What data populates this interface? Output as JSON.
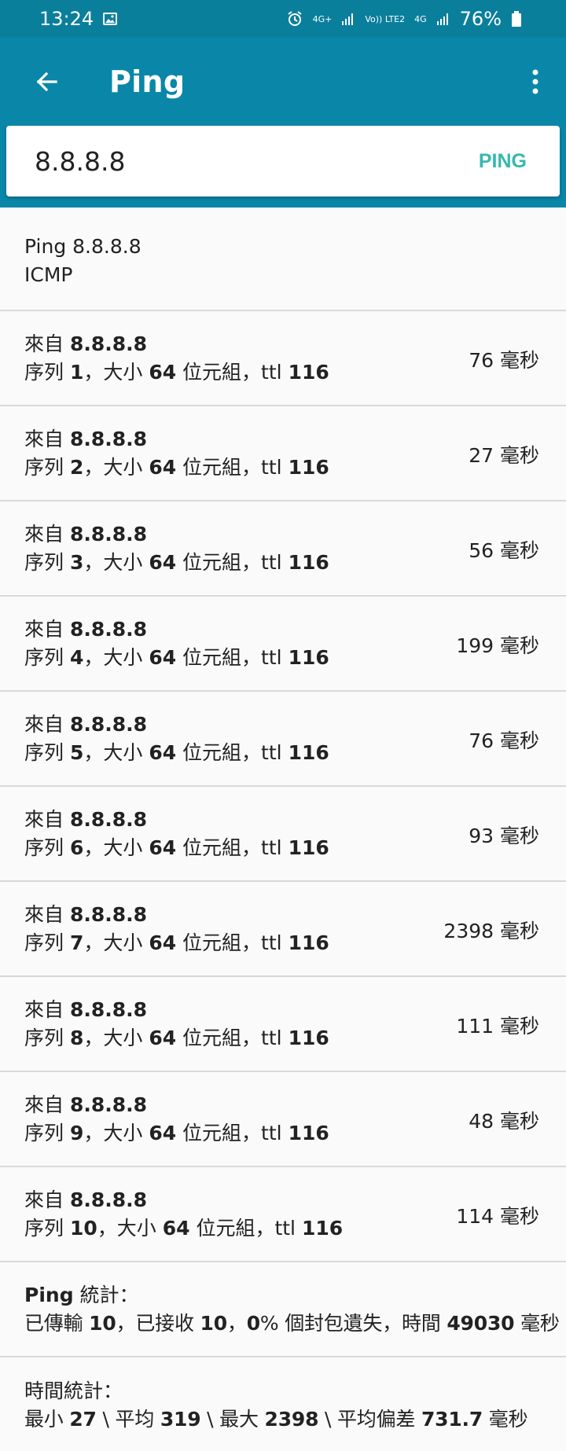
{
  "status_bar": {
    "time": "13:24",
    "signal_4g_plus": "4G+",
    "signal_lte2": "Vo)) LTE2",
    "signal_4g": "4G",
    "battery": "76%"
  },
  "app_bar": {
    "title": "Ping"
  },
  "search": {
    "value": "8.8.8.8",
    "ping_label": "PING"
  },
  "header": {
    "line1": "Ping 8.8.8.8",
    "line2": "ICMP"
  },
  "results": [
    {
      "from_prefix": "來自 ",
      "host": "8.8.8.8",
      "seq_prefix": "序列 ",
      "seq": "1",
      "size_prefix": "，大小 ",
      "size": "64",
      "size_unit": " 位元組，ttl ",
      "ttl": "116",
      "time": "76 毫秒"
    },
    {
      "from_prefix": "來自 ",
      "host": "8.8.8.8",
      "seq_prefix": "序列 ",
      "seq": "2",
      "size_prefix": "，大小 ",
      "size": "64",
      "size_unit": " 位元組，ttl ",
      "ttl": "116",
      "time": "27 毫秒"
    },
    {
      "from_prefix": "來自 ",
      "host": "8.8.8.8",
      "seq_prefix": "序列 ",
      "seq": "3",
      "size_prefix": "，大小 ",
      "size": "64",
      "size_unit": " 位元組，ttl ",
      "ttl": "116",
      "time": "56 毫秒"
    },
    {
      "from_prefix": "來自 ",
      "host": "8.8.8.8",
      "seq_prefix": "序列 ",
      "seq": "4",
      "size_prefix": "，大小 ",
      "size": "64",
      "size_unit": " 位元組，ttl ",
      "ttl": "116",
      "time": "199 毫秒"
    },
    {
      "from_prefix": "來自 ",
      "host": "8.8.8.8",
      "seq_prefix": "序列 ",
      "seq": "5",
      "size_prefix": "，大小 ",
      "size": "64",
      "size_unit": " 位元組，ttl ",
      "ttl": "116",
      "time": "76 毫秒"
    },
    {
      "from_prefix": "來自 ",
      "host": "8.8.8.8",
      "seq_prefix": "序列 ",
      "seq": "6",
      "size_prefix": "，大小 ",
      "size": "64",
      "size_unit": " 位元組，ttl ",
      "ttl": "116",
      "time": "93 毫秒"
    },
    {
      "from_prefix": "來自 ",
      "host": "8.8.8.8",
      "seq_prefix": "序列 ",
      "seq": "7",
      "size_prefix": "，大小 ",
      "size": "64",
      "size_unit": " 位元組，ttl ",
      "ttl": "116",
      "time": "2398 毫秒"
    },
    {
      "from_prefix": "來自 ",
      "host": "8.8.8.8",
      "seq_prefix": "序列 ",
      "seq": "8",
      "size_prefix": "，大小 ",
      "size": "64",
      "size_unit": " 位元組，ttl ",
      "ttl": "116",
      "time": "111 毫秒"
    },
    {
      "from_prefix": "來自 ",
      "host": "8.8.8.8",
      "seq_prefix": "序列 ",
      "seq": "9",
      "size_prefix": "，大小 ",
      "size": "64",
      "size_unit": " 位元組，ttl ",
      "ttl": "116",
      "time": "48 毫秒"
    },
    {
      "from_prefix": "來自 ",
      "host": "8.8.8.8",
      "seq_prefix": "序列 ",
      "seq": "10",
      "size_prefix": "，大小 ",
      "size": "64",
      "size_unit": " 位元組，ttl ",
      "ttl": "116",
      "time": "114 毫秒"
    }
  ],
  "ping_stats": {
    "title_bold": "Ping",
    "title_rest": " 統計：",
    "line2_a": "已傳輸 ",
    "transmitted": "10",
    "line2_b": "，已接收 ",
    "received": "10",
    "line2_c": "，",
    "loss": "0",
    "line2_d": "% 個封包遺失，時間 ",
    "time_total": "49030",
    "line2_e": " 毫秒"
  },
  "time_stats": {
    "title": "時間統計：",
    "min_label": "最小 ",
    "min": "27",
    "avg_label": " \\ 平均 ",
    "avg": "319",
    "max_label": " \\ 最大 ",
    "max": "2398",
    "mdev_label": " \\ 平均偏差 ",
    "mdev": "731.7",
    "unit": " 毫秒"
  },
  "colors": {
    "status_bar": "#0a7f9c",
    "app_bar": "#0a87a8",
    "ping_button": "#35b8b0",
    "divider": "#d9d9d9"
  },
  "icons": {
    "back": "arrow-left-icon",
    "menu": "more-vertical-icon",
    "image": "image-icon",
    "alarm": "alarm-icon",
    "signal": "signal-bars-icon",
    "battery": "battery-icon"
  }
}
